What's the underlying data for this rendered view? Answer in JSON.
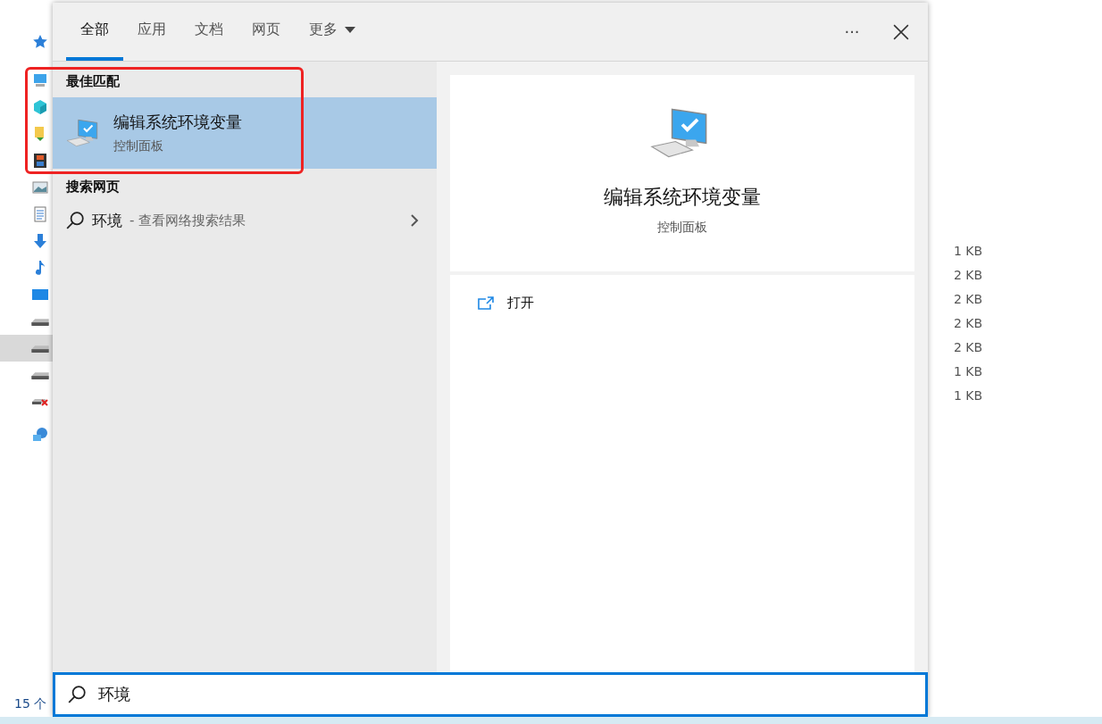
{
  "explorer": {
    "nav": [
      {
        "kind": "star",
        "selected": false
      },
      {
        "kind": "computer",
        "selected": false
      },
      {
        "kind": "cube",
        "selected": false
      },
      {
        "kind": "folder",
        "selected": false
      },
      {
        "kind": "film",
        "selected": false
      },
      {
        "kind": "image",
        "selected": false
      },
      {
        "kind": "document",
        "selected": false
      },
      {
        "kind": "download",
        "selected": false
      },
      {
        "kind": "music",
        "selected": false
      },
      {
        "kind": "desktop",
        "selected": false
      },
      {
        "kind": "drive",
        "selected": false
      },
      {
        "kind": "drive",
        "selected": true
      },
      {
        "kind": "drive",
        "selected": false
      },
      {
        "kind": "drive-error",
        "selected": false
      },
      {
        "kind": "network",
        "selected": false
      }
    ],
    "sizes": [
      "1 KB",
      "2 KB",
      "2 KB",
      "2 KB",
      "2 KB",
      "1 KB",
      "1 KB"
    ],
    "status": "15 个"
  },
  "search": {
    "tabs": [
      {
        "label": "全部",
        "selected": true,
        "dropdown": false
      },
      {
        "label": "应用",
        "selected": false,
        "dropdown": false
      },
      {
        "label": "文档",
        "selected": false,
        "dropdown": false
      },
      {
        "label": "网页",
        "selected": false,
        "dropdown": false
      },
      {
        "label": "更多",
        "selected": false,
        "dropdown": true
      }
    ],
    "more_button": "···",
    "best_match": {
      "heading": "最佳匹配",
      "title": "编辑系统环境变量",
      "subtitle": "控制面板",
      "selected": true,
      "highlighted": true
    },
    "web": {
      "heading": "搜索网页",
      "query": "环境",
      "hint": "- 查看网络搜索结果"
    },
    "preview": {
      "title": "编辑系统环境变量",
      "subtitle": "控制面板",
      "actions": [
        {
          "label": "打开"
        }
      ]
    },
    "query": "环境"
  }
}
